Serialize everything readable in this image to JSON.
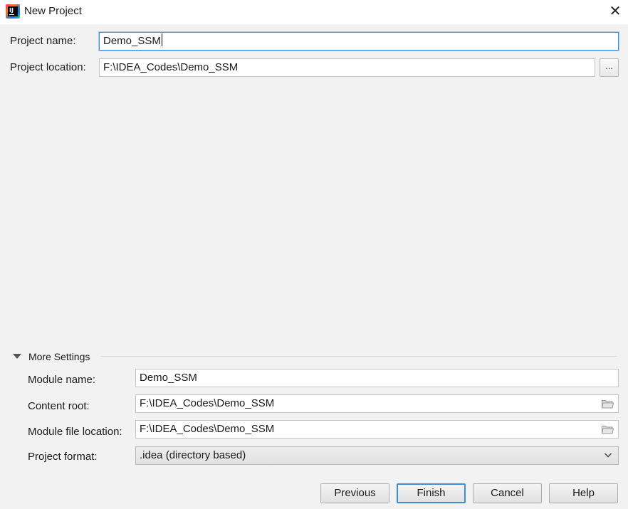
{
  "window": {
    "title": "New Project",
    "close_glyph": "✕"
  },
  "project": {
    "name_label": "Project name:",
    "name_value": "Demo_SSM",
    "location_label": "Project location:",
    "location_value": "F:\\IDEA_Codes\\Demo_SSM",
    "browse_label": "..."
  },
  "more_settings": {
    "section_label": "More Settings",
    "module_name_label": "Module name:",
    "module_name_value": "Demo_SSM",
    "content_root_label": "Content root:",
    "content_root_value": "F:\\IDEA_Codes\\Demo_SSM",
    "module_file_label": "Module file location:",
    "module_file_value": "F:\\IDEA_Codes\\Demo_SSM",
    "format_label": "Project format:",
    "format_value": ".idea (directory based)"
  },
  "buttons": {
    "previous": "Previous",
    "finish": "Finish",
    "cancel": "Cancel",
    "help": "Help"
  },
  "icons": {
    "app": "intellij-idea-icon",
    "close": "close-icon",
    "folder": "folder-icon",
    "chevron": "chevron-down-icon",
    "collapse": "triangle-down-icon"
  },
  "colors": {
    "focus": "#3c8fd7",
    "background": "#f2f2f2"
  }
}
